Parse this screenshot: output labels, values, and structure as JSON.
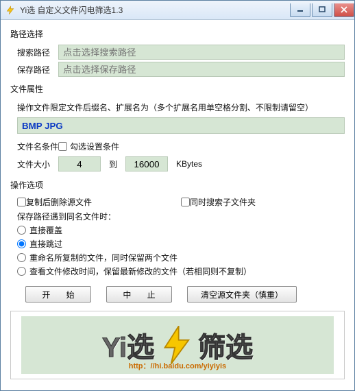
{
  "window": {
    "title": "Yi选   自定义文件闪电筛选1.3"
  },
  "section_path": {
    "title": "路径选择",
    "search_label": "搜索路径",
    "search_placeholder": "点击选择搜索路径",
    "save_label": "保存路径",
    "save_placeholder": "点击选择保存路径"
  },
  "section_attr": {
    "title": "文件属性",
    "hint": "操作文件限定文件后缀名、扩展名为（多个扩展名用单空格分割、不限制请留空）",
    "ext_value": "BMP JPG",
    "name_cond_label": "文件名条件",
    "name_cond_checkbox": "勾选设置条件",
    "size_label": "文件大小",
    "size_from": "4",
    "size_mid": "到",
    "size_to": "16000",
    "size_unit": "KBytes"
  },
  "section_ops": {
    "title": "操作选项",
    "delete_source": "复制后删除源文件",
    "search_sub": "同时搜索子文件夹",
    "samefile_label": "保存路径遇到同名文件时：",
    "radios": {
      "overwrite": "直接覆盖",
      "skip": "直接跳过",
      "rename": "重命名所复制的文件，同时保留两个文件",
      "mtime": "查看文件修改时间，保留最新修改的文件（若相同则不复制）"
    }
  },
  "buttons": {
    "start": "开 始",
    "stop": "中 止",
    "clear": "清空源文件夹（慎重）"
  },
  "banner": {
    "left": "Yi选",
    "right": "筛选",
    "url": "http：//hi.baidu.com/yiyiyis"
  }
}
